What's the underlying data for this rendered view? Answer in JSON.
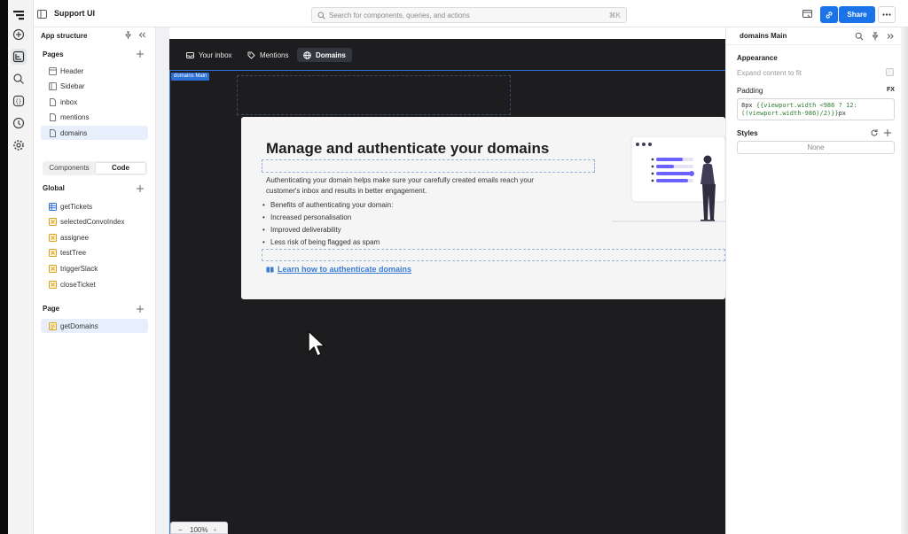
{
  "app": {
    "title": "Support UI"
  },
  "search": {
    "placeholder": "Search for components, queries, and actions",
    "shortcut": "⌘K"
  },
  "toolbar": {
    "share_label": "Share"
  },
  "left_panel": {
    "title": "App structure",
    "pages_title": "Pages",
    "pages": [
      "Header",
      "Sidebar",
      "inbox",
      "mentions",
      "domains"
    ],
    "selected_page": "domains",
    "segments": [
      "Components",
      "Code"
    ],
    "active_segment": "Code",
    "global_title": "Global",
    "global_items": [
      "getTickets",
      "selectedConvoIndex",
      "assignee",
      "testTree",
      "triggerSlack",
      "closeTicket"
    ],
    "page_title": "Page",
    "page_items": [
      "getDomains"
    ]
  },
  "canvas": {
    "tabs": [
      "Your inbox",
      "Mentions",
      "Domains"
    ],
    "active_tab": "Domains",
    "frame_tag": "domains Main",
    "card": {
      "heading": "Manage and authenticate your domains",
      "description": "Authenticating your domain helps make sure your carefully created emails reach your customer's inbox and results in better engagement.",
      "bullets": [
        "Benefits of authenticating your domain:",
        "Increased personalisation",
        "Improved deliverability",
        "Less risk of being flagged as spam"
      ],
      "link_text": "Learn how to authenticate domains"
    },
    "zoom": "100%"
  },
  "inspector": {
    "title": "domains Main",
    "appearance_label": "Appearance",
    "expand_label": "Expand content to fit",
    "padding_label": "Padding",
    "fx_label": "FX",
    "padding_code_line1_prefix": "8px ",
    "padding_code_line1_tpl": "{{viewport.width <986 ? 12:",
    "padding_code_line2_tpl": "((viewport.width-986)/2)}}",
    "padding_code_line2_suffix": "px",
    "styles_label": "Styles",
    "styles_value": "None"
  },
  "colors": {
    "accent": "#1a73e8",
    "canvas_bg": "#1d1d1f",
    "link": "#3a7bd5",
    "selection": "#e6effb"
  }
}
